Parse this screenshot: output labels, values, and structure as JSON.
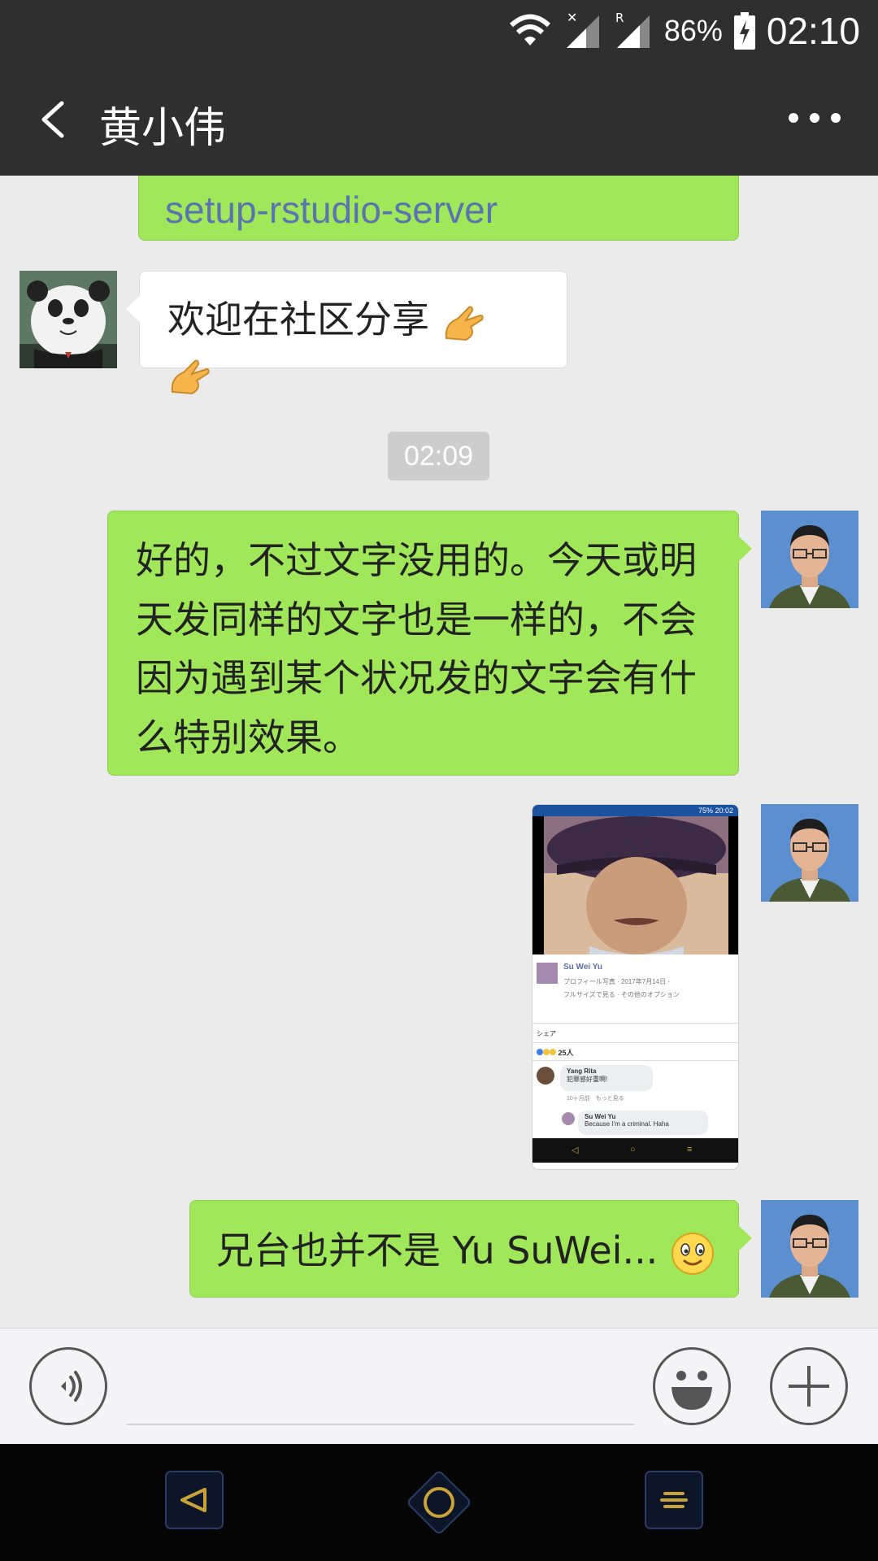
{
  "status_bar": {
    "battery_percent": "86%",
    "time": "02:10",
    "sim_label": "R"
  },
  "header": {
    "title": "黄小伟",
    "back_icon": "chevron-left-icon",
    "more_icon": "more-dots-icon"
  },
  "messages": [
    {
      "side": "right",
      "type": "text",
      "text": "setup-rstudio-server",
      "color": "#5b74b0"
    },
    {
      "side": "left",
      "type": "text",
      "text": "欢迎在社区分享"
    },
    {
      "type": "timestamp",
      "text": "02:09"
    },
    {
      "side": "right",
      "type": "text",
      "text": "好的，不过文字没用的。今天或明天发同样的文字也是一样的，不会因为遇到某个状况发的文字会有什么特别效果。"
    },
    {
      "side": "right",
      "type": "image",
      "image": {
        "status_time": "20:02",
        "status_pct": "75%",
        "name": "Su Wei Yu",
        "caption": "プロフィール写真 · 2017年7月14日 ·",
        "options": "フルサイズで見る · その他のオプション",
        "share": "シェア",
        "reactions": "25人",
        "comment_author": "Yang Rita",
        "comment_text": "犯罪感好重啊!",
        "comment_meta": "10ヶ月前　もっと見る",
        "reply_author": "Su Wei Yu",
        "reply_text": "Because I'm a criminal. Haha"
      }
    },
    {
      "side": "right",
      "type": "text",
      "text": "兄台也并不是 Yu SuWei..."
    }
  ],
  "input_bar": {
    "voice_icon": "voice-icon",
    "emoji_icon": "smiley-icon",
    "plus_icon": "plus-icon"
  },
  "colors": {
    "bar_bg": "#2f2f2f",
    "chat_bg": "#ebebeb",
    "green_bubble": "#a0e75a",
    "link_text": "#5b74b0",
    "nav_accent": "#c9a338"
  }
}
